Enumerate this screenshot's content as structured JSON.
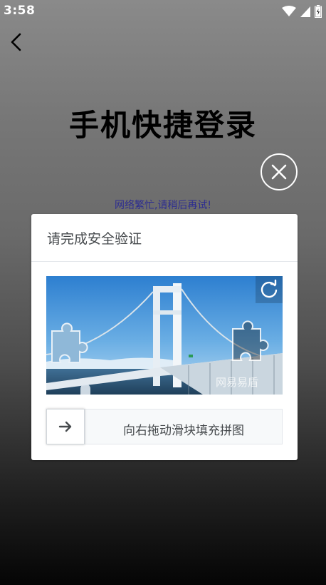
{
  "status_bar": {
    "time": "3:58",
    "icons": [
      "wifi-icon",
      "signal-icon",
      "battery-icon"
    ]
  },
  "header": {
    "back_icon": "chevron-left-icon",
    "title": "手机快捷登录"
  },
  "close_icon": "close-circle-icon",
  "error_message": "网络繁忙,请稍后再试!",
  "captcha": {
    "title": "请完成安全验证",
    "image_alt": "bridge puzzle image",
    "refresh_icon": "refresh-icon",
    "watermark": "网易易盾",
    "slider_icon": "arrow-right-icon",
    "slider_text": "向右拖动滑块填充拼图"
  },
  "colors": {
    "dialog_text": "#45494c",
    "error_text": "#2e2e90",
    "slider_bg": "#f7f9fa"
  }
}
